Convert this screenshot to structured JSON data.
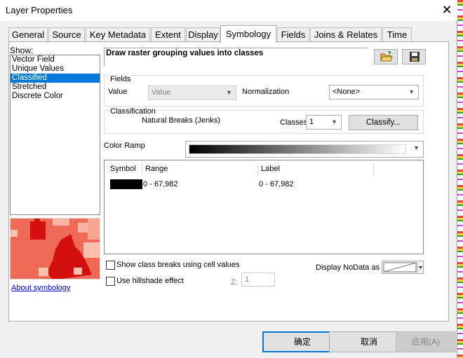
{
  "window": {
    "title": "Layer Properties",
    "close_glyph": "✕"
  },
  "tabs": [
    {
      "label": "General"
    },
    {
      "label": "Source"
    },
    {
      "label": "Key Metadata"
    },
    {
      "label": "Extent"
    },
    {
      "label": "Display"
    },
    {
      "label": "Symbology",
      "active": true
    },
    {
      "label": "Fields"
    },
    {
      "label": "Joins & Relates"
    },
    {
      "label": "Time"
    }
  ],
  "show": {
    "label": "Show:",
    "items": [
      "Vector Field",
      "Unique Values",
      "Classified",
      "Stretched",
      "Discrete Color"
    ],
    "selected": "Classified"
  },
  "about_link": "About symbology",
  "heading": "Draw raster grouping values into classes",
  "icons": {
    "open": "open-folder-icon",
    "save": "save-disk-icon"
  },
  "fields": {
    "group_label": "Fields",
    "value_label": "Value",
    "value_selected": "Value",
    "normalization_label": "Normalization",
    "normalization_selected": "<None>"
  },
  "classification": {
    "group_label": "Classification",
    "method": "Natural Breaks (Jenks)",
    "classes_label": "Classes",
    "classes_value": "1",
    "classify_button": "Classify..."
  },
  "color_ramp": {
    "label": "Color Ramp",
    "from": "#000000",
    "to": "#ffffff"
  },
  "grid": {
    "columns": [
      "Symbol",
      "Range",
      "Label"
    ],
    "rows": [
      {
        "symbol_color": "#000000",
        "range": "0 - 67,982",
        "label": "0 - 67,982"
      }
    ]
  },
  "options": {
    "show_breaks_label": "Show class breaks using cell values",
    "hillshade_label": "Use hillshade effect",
    "z_label": "Z:",
    "z_value": "1",
    "nodata_label": "Display NoData as"
  },
  "buttons": {
    "ok": "确定",
    "cancel": "取消",
    "apply": "应用(A)"
  },
  "colors": {
    "accent": "#0078d7",
    "selection": "#0078d7",
    "link": "#0000ee",
    "preview_red": "#e5302a",
    "preview_light": "#f79b86"
  }
}
